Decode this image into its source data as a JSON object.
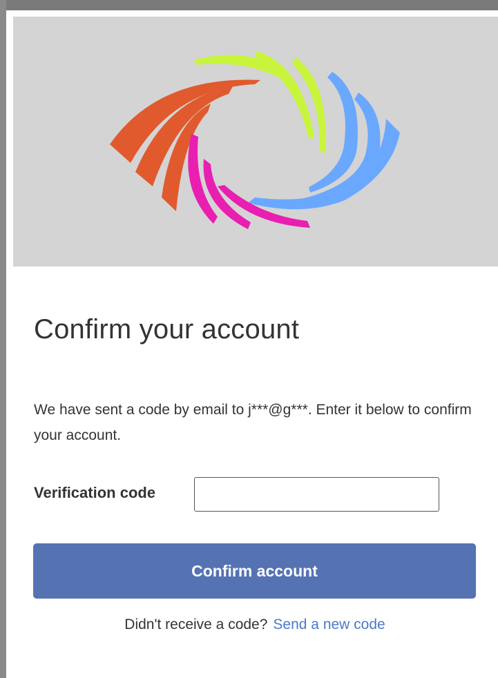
{
  "logo": {
    "icon": "swirl-eye-logo",
    "colors": {
      "orange": "#e05a2e",
      "lime": "#c8f53c",
      "blue": "#6aa8ff",
      "magenta": "#e81fb1"
    }
  },
  "page": {
    "title": "Confirm your account",
    "message": "We have sent a code by email to j***@g***. Enter it below to confirm your account."
  },
  "form": {
    "code_label": "Verification code",
    "code_value": "",
    "submit_label": "Confirm account"
  },
  "resend": {
    "prompt": "Didn't receive a code?",
    "link_label": "Send a new code"
  },
  "colors": {
    "button": "#5572b3",
    "link": "#4a79c9",
    "banner": "#d4d4d4"
  }
}
